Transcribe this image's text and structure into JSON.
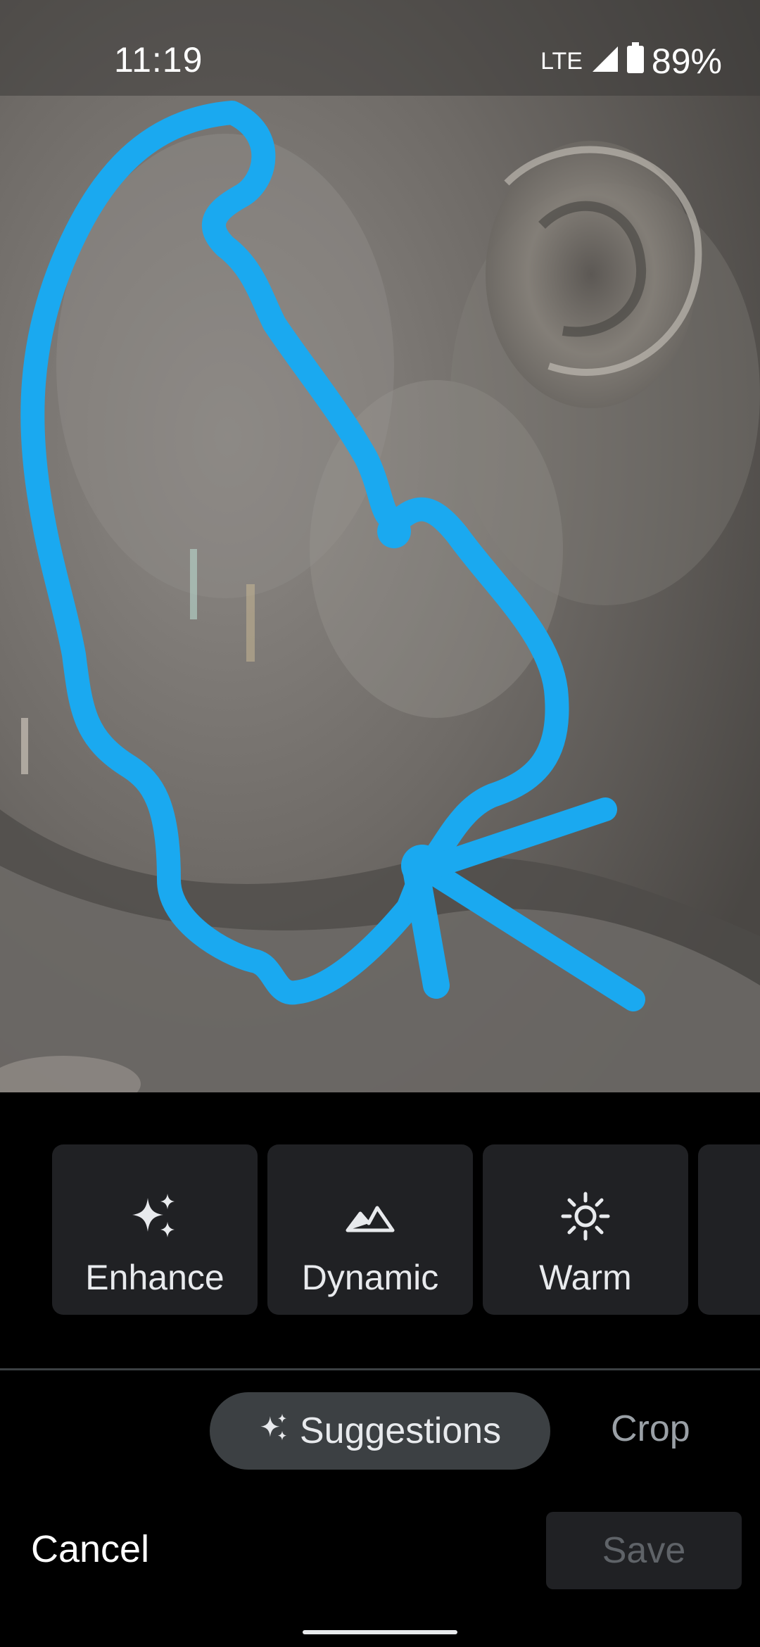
{
  "status_bar": {
    "time": "11:19",
    "network": "LTE",
    "battery": "89%"
  },
  "photo": {
    "description_icon": "coin-closeup-image",
    "annotation_color": "#1aa9f0"
  },
  "suggestions": [
    {
      "label": "Enhance",
      "icon": "sparkle-icon"
    },
    {
      "label": "Dynamic",
      "icon": "mountain-icon"
    },
    {
      "label": "Warm",
      "icon": "sun-icon"
    }
  ],
  "tabs": {
    "suggestions_label": "Suggestions",
    "crop_label": "Crop"
  },
  "actions": {
    "cancel_label": "Cancel",
    "save_label": "Save"
  },
  "colors": {
    "card_bg": "#202124",
    "active_tab_bg": "#3c4043",
    "accent_stroke": "#1aa9f0"
  }
}
